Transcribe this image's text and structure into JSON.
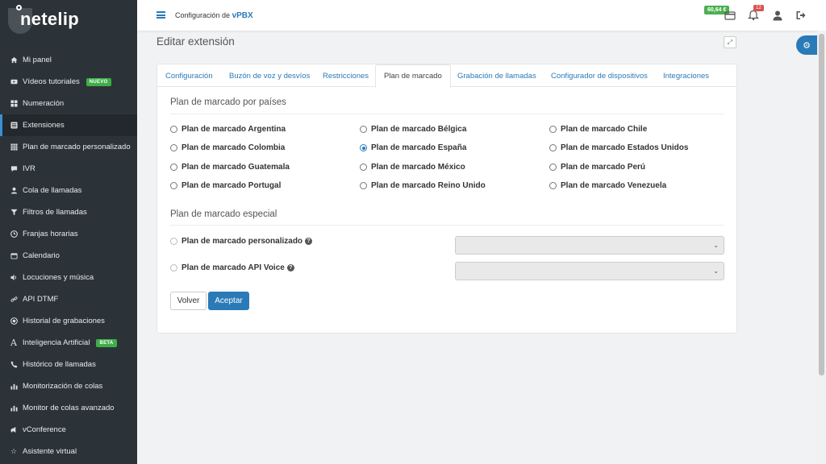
{
  "brand": {
    "logo_text": "netelip"
  },
  "sidebar": {
    "items": [
      {
        "label": "Mi panel",
        "icon": "home-icon"
      },
      {
        "label": "Vídeos tutoriales",
        "icon": "video-icon",
        "badge": "NUEVO"
      },
      {
        "label": "Numeración",
        "icon": "grid-icon"
      },
      {
        "label": "Extensiones",
        "icon": "list-icon",
        "active": true
      },
      {
        "label": "Plan de marcado personalizado",
        "icon": "grid-dots-icon"
      },
      {
        "label": "IVR",
        "icon": "chat-icon"
      },
      {
        "label": "Cola de llamadas",
        "icon": "user-icon"
      },
      {
        "label": "Filtros de llamadas",
        "icon": "filter-icon"
      },
      {
        "label": "Franjas horarias",
        "icon": "clock-icon"
      },
      {
        "label": "Calendario",
        "icon": "calendar-icon"
      },
      {
        "label": "Locuciones y música",
        "icon": "volume-icon"
      },
      {
        "label": "API DTMF",
        "icon": "link-icon"
      },
      {
        "label": "Historial de grabaciones",
        "icon": "record-icon"
      },
      {
        "label": "Inteligencia Artificial",
        "icon": "ai-icon",
        "badge": "BETA"
      },
      {
        "label": "Histórico de llamadas",
        "icon": "phone-icon"
      },
      {
        "label": "Monitorización de colas",
        "icon": "bar-chart-icon"
      },
      {
        "label": "Monitor de colas avanzado",
        "icon": "bar-chart-icon"
      },
      {
        "label": "vConference",
        "icon": "conference-icon"
      },
      {
        "label": "Asistente virtual",
        "icon": "star-icon"
      }
    ]
  },
  "topbar": {
    "title_prefix": "Configuración de",
    "title_strong": "vPBX",
    "balance": "60,64 €",
    "notifications_count": "12"
  },
  "page": {
    "title": "Editar extensión"
  },
  "tabs": [
    {
      "label": "Configuración"
    },
    {
      "label": "Buzón de voz y desvíos"
    },
    {
      "label": "Restricciones"
    },
    {
      "label": "Plan de marcado",
      "active": true
    },
    {
      "label": "Grabación de llamadas"
    },
    {
      "label": "Configurador de dispositivos"
    },
    {
      "label": "Integraciones"
    }
  ],
  "country_section": {
    "title": "Plan de marcado por países",
    "options": [
      {
        "label": "Plan de marcado Argentina",
        "checked": false
      },
      {
        "label": "Plan de marcado Bélgica",
        "checked": false
      },
      {
        "label": "Plan de marcado Chile",
        "checked": false
      },
      {
        "label": "Plan de marcado Colombia",
        "checked": false
      },
      {
        "label": "Plan de marcado España",
        "checked": true
      },
      {
        "label": "Plan de marcado Estados Unidos",
        "checked": false
      },
      {
        "label": "Plan de marcado Guatemala",
        "checked": false
      },
      {
        "label": "Plan de marcado México",
        "checked": false
      },
      {
        "label": "Plan de marcado Perú",
        "checked": false
      },
      {
        "label": "Plan de marcado Portugal",
        "checked": false
      },
      {
        "label": "Plan de marcado Reino Unido",
        "checked": false
      },
      {
        "label": "Plan de marcado Venezuela",
        "checked": false
      }
    ]
  },
  "special_section": {
    "title": "Plan de marcado especial",
    "options": [
      {
        "label": "Plan de marcado personalizado",
        "select_value": ""
      },
      {
        "label": "Plan de marcado API Voice",
        "select_value": ""
      }
    ]
  },
  "actions": {
    "back_label": "Volver",
    "accept_label": "Aceptar"
  },
  "colors": {
    "accent": "#2a7ab8",
    "sidebar_bg": "#2c3338",
    "balance_bg": "#4caf50",
    "badge_bg": "#3fae49",
    "notification_bg": "#d9534f"
  }
}
